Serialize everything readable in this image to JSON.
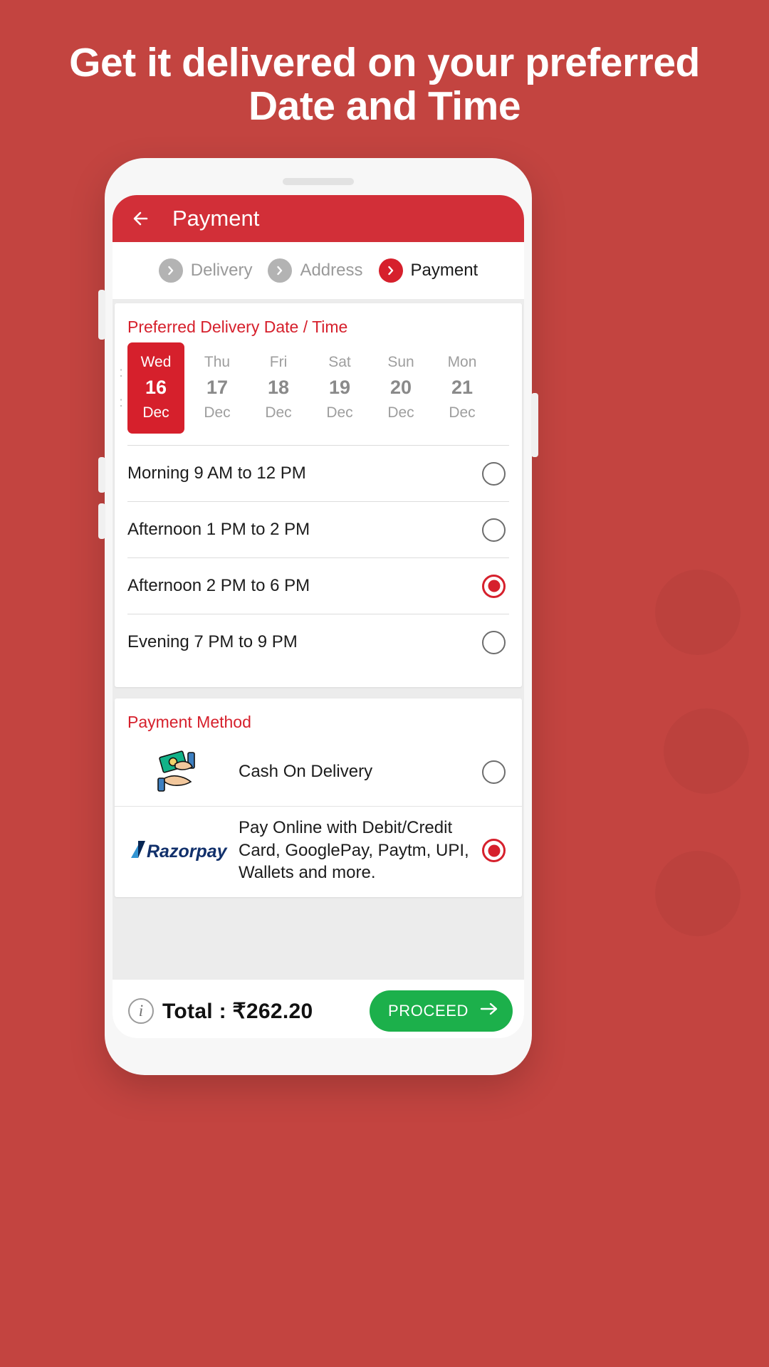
{
  "promo": {
    "headline": "Get it delivered on your preferred Date and Time"
  },
  "colors": {
    "background": "#c34440",
    "brand_red": "#d22f38",
    "accent_red": "#d6202c",
    "proceed_green": "#1cb04b"
  },
  "appbar": {
    "back_icon": "back-arrow-icon",
    "title": "Payment"
  },
  "breadcrumb": {
    "steps": [
      {
        "label": "Delivery",
        "icon": "chevron-right-icon",
        "active": false
      },
      {
        "label": "Address",
        "icon": "chevron-right-icon",
        "active": false
      },
      {
        "label": "Payment",
        "icon": "chevron-right-icon",
        "active": true
      }
    ]
  },
  "delivery": {
    "title": "Preferred Delivery Date / Time",
    "edge_left": ":",
    "dates": [
      {
        "dow": "Wed",
        "day": "16",
        "mon": "Dec",
        "selected": true
      },
      {
        "dow": "Thu",
        "day": "17",
        "mon": "Dec",
        "selected": false
      },
      {
        "dow": "Fri",
        "day": "18",
        "mon": "Dec",
        "selected": false
      },
      {
        "dow": "Sat",
        "day": "19",
        "mon": "Dec",
        "selected": false
      },
      {
        "dow": "Sun",
        "day": "20",
        "mon": "Dec",
        "selected": false
      },
      {
        "dow": "Mon",
        "day": "21",
        "mon": "Dec",
        "selected": false
      }
    ],
    "slots": [
      {
        "label": "Morning 9 AM to 12 PM",
        "selected": false
      },
      {
        "label": "Afternoon 1 PM to 2 PM",
        "selected": false
      },
      {
        "label": "Afternoon 2 PM to 6 PM",
        "selected": true
      },
      {
        "label": "Evening 7 PM to 9 PM",
        "selected": false
      }
    ]
  },
  "payment": {
    "title": "Payment Method",
    "methods": [
      {
        "logo": "cash-on-delivery-icon",
        "label": "Cash On Delivery",
        "selected": false
      },
      {
        "logo": "razorpay-logo",
        "label": "Pay Online with Debit/Credit Card, GooglePay, Paytm, UPI, Wallets and more.",
        "selected": true
      }
    ]
  },
  "footer": {
    "info_icon": "info-icon",
    "total_label": "Total : ₹262.20",
    "proceed_label": "PROCEED",
    "proceed_icon": "arrow-right-icon"
  }
}
